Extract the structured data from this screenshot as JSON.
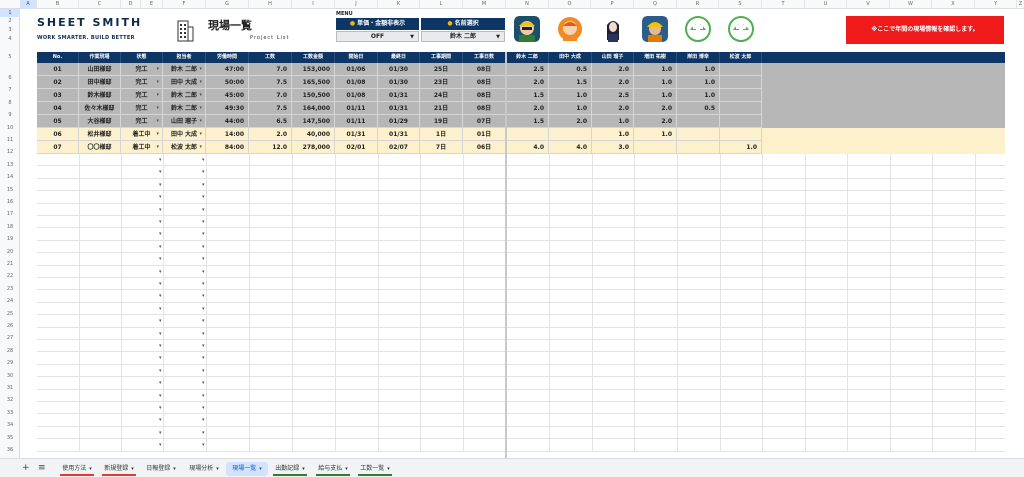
{
  "columns": [
    "A",
    "B",
    "C",
    "D",
    "E",
    "F",
    "G",
    "H",
    "I",
    "J",
    "K",
    "L",
    "M",
    "N",
    "O",
    "P",
    "Q",
    "R",
    "S",
    "T",
    "U",
    "V",
    "W",
    "X",
    "Y",
    "Z"
  ],
  "rows": [
    "1",
    "2",
    "3",
    "4",
    "5",
    "6",
    "7",
    "8",
    "9",
    "10",
    "11",
    "12",
    "13",
    "14",
    "15",
    "16",
    "17",
    "18",
    "19",
    "20",
    "21",
    "22",
    "23",
    "24",
    "25",
    "26",
    "27",
    "28",
    "29",
    "30",
    "31",
    "32",
    "33",
    "34",
    "35",
    "36"
  ],
  "logo": {
    "title": "SHEET SMITH",
    "tagline": "WORK SMARTER. BUILD BETTER"
  },
  "page": {
    "title": "現場一覧",
    "subtitle": "Project List"
  },
  "menu": {
    "label": "MENU",
    "toggle_label": "単価・金額非表示",
    "toggle_value": "OFF",
    "name_label": "名前選択",
    "name_value": "鈴木 二郎"
  },
  "alert": {
    "text": "※ここで年間の現場情報を確認します。"
  },
  "table": {
    "headers": [
      "No.",
      "作業現場",
      "状態",
      "担当者",
      "労働時間",
      "工数",
      "工数金額",
      "開始日",
      "最終日",
      "工事期間",
      "工事日数",
      "鈴木 二郎",
      "田中 大成",
      "山田 瑠子",
      "増田 祐樹",
      "岸田 博幸",
      "松波 太郎"
    ],
    "rows": [
      [
        "01",
        "山田様邸",
        "完工",
        "鈴木 二郎",
        "47:00",
        "7.0",
        "153,000",
        "01/06",
        "01/30",
        "25日",
        "08日",
        "2.5",
        "0.5",
        "2.0",
        "1.0",
        "1.0",
        ""
      ],
      [
        "02",
        "田中様邸",
        "完工",
        "田中 大成",
        "50:00",
        "7.5",
        "165,500",
        "01/08",
        "01/30",
        "23日",
        "08日",
        "2.0",
        "1.5",
        "2.0",
        "1.0",
        "1.0",
        ""
      ],
      [
        "03",
        "鈴木様邸",
        "完工",
        "鈴木 二郎",
        "45:00",
        "7.0",
        "150,500",
        "01/08",
        "01/31",
        "24日",
        "08日",
        "1.5",
        "1.0",
        "2.5",
        "1.0",
        "1.0",
        ""
      ],
      [
        "04",
        "佐々木様邸",
        "完工",
        "鈴木 二郎",
        "49:30",
        "7.5",
        "164,000",
        "01/11",
        "01/31",
        "21日",
        "08日",
        "2.0",
        "1.0",
        "2.0",
        "2.0",
        "0.5",
        ""
      ],
      [
        "05",
        "大谷様邸",
        "完工",
        "山田 瑠子",
        "44:00",
        "6.5",
        "147,500",
        "01/11",
        "01/29",
        "19日",
        "07日",
        "1.5",
        "2.0",
        "1.0",
        "2.0",
        "",
        ""
      ],
      [
        "06",
        "松井様邸",
        "着工中",
        "田中 大成",
        "14:00",
        "2.0",
        "40,000",
        "01/31",
        "01/31",
        "1日",
        "01日",
        "",
        "",
        "1.0",
        "1.0",
        "",
        ""
      ],
      [
        "07",
        "〇〇様邸",
        "着工中",
        "松波 太郎",
        "84:00",
        "12.0",
        "278,000",
        "02/01",
        "02/07",
        "7日",
        "06日",
        "4.0",
        "4.0",
        "3.0",
        "",
        "",
        "1.0"
      ]
    ]
  },
  "tabs": [
    "使用方法",
    "新規登録",
    "日報登録",
    "現場分析",
    "現場一覧",
    "出勤記録",
    "給与支払",
    "工数一覧"
  ],
  "colors": {
    "navy": "#0d3566",
    "done_row": "#b7b7b7",
    "in_progress_row": "#fdf0cc",
    "alert": "#f01a1a"
  }
}
